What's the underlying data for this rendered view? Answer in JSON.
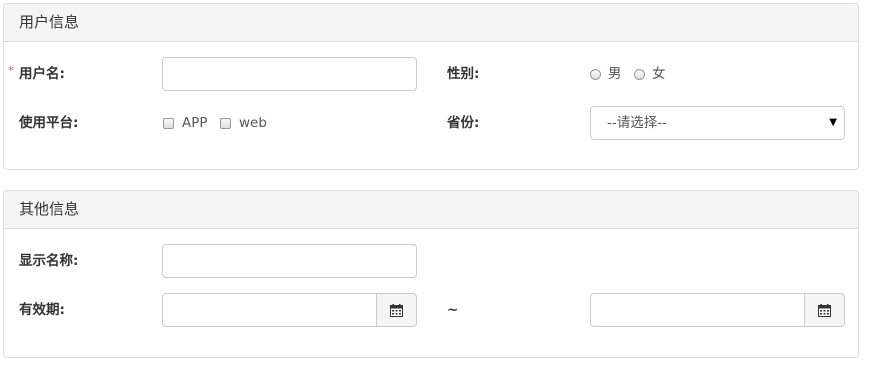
{
  "user_panel": {
    "title": "用户信息",
    "required_mark": "*",
    "username_label": "用户名:",
    "username_value": "",
    "gender_label": "性别:",
    "gender_options": [
      "男",
      "女"
    ],
    "platform_label": "使用平台:",
    "platform_options": [
      "APP",
      "web"
    ],
    "province_label": "省份:",
    "province_selected": "--请选择--"
  },
  "other_panel": {
    "title": "其他信息",
    "display_name_label": "显示名称:",
    "display_name_value": "",
    "validity_label": "有效期:",
    "range_separator": "~",
    "start_date_value": "",
    "end_date_value": ""
  },
  "icons": {
    "calendar": "calendar-icon",
    "dropdown": "caret-down-icon"
  },
  "colors": {
    "required": "#d9534f",
    "panel_heading_bg": "#f5f5f5",
    "border": "#dddddd"
  }
}
